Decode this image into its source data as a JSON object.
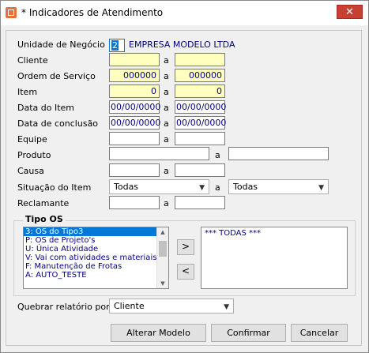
{
  "window": {
    "title": "* Indicadores de Atendimento",
    "close_label": "✕"
  },
  "form": {
    "unidade_label": "Unidade de Negócio",
    "unidade_code": "2",
    "unidade_name": "EMPRESA MODELO LTDA",
    "a_sep": "a",
    "cliente_label": "Cliente",
    "ordem_label": "Ordem de Serviço",
    "ordem_from": "000000",
    "ordem_to": "000000",
    "item_label": "Item",
    "item_from": "0",
    "item_to": "0",
    "data_item_label": "Data do Item",
    "data_item_from": "00/00/0000",
    "data_item_to": "00/00/0000",
    "data_conc_label": "Data de conclusão",
    "data_conc_from": "00/00/0000",
    "data_conc_to": "00/00/0000",
    "equipe_label": "Equipe",
    "produto_label": "Produto",
    "causa_label": "Causa",
    "situacao_label": "Situação do Item",
    "situacao_from": "Todas",
    "situacao_to": "Todas",
    "reclamante_label": "Reclamante"
  },
  "tipo_os": {
    "title": "Tipo OS",
    "items": [
      "3: OS do Tipo3",
      "P: OS de Projeto's",
      "U: Única Atividade",
      "V: Vai com atividades e materiais",
      "F: Manutenção de Frotas",
      "A: AUTO_TESTE"
    ],
    "selected_index": 0,
    "add_label": ">",
    "remove_label": "<",
    "selected_items": [
      "*** TODAS ***"
    ]
  },
  "quebrar": {
    "label": "Quebrar relatório por",
    "value": "Cliente"
  },
  "buttons": {
    "alterar": "Alterar Modelo",
    "confirmar": "Confirmar",
    "cancelar": "Cancelar"
  },
  "colors": {
    "accent": "#0078d7",
    "yellow_field": "#ffffc0",
    "value_blue": "#000080"
  }
}
